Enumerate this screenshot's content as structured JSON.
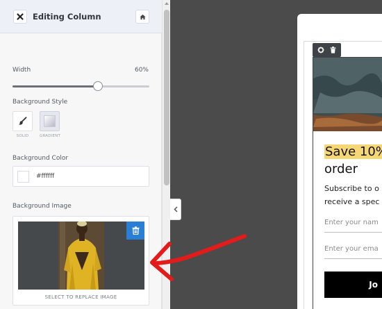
{
  "header": {
    "title": "Editing Column",
    "close_icon": "close-icon",
    "home_icon": "home-icon"
  },
  "width": {
    "label": "Width",
    "value_label": "60%",
    "value": 0.6
  },
  "background_style": {
    "label": "Background Style",
    "options": [
      {
        "caption": "SOLID",
        "icon": "brush-icon",
        "selected": false
      },
      {
        "caption": "GRADIENT",
        "icon": "gradient-icon",
        "selected": true
      }
    ]
  },
  "background_color": {
    "label": "Background Color",
    "value": "#ffffff"
  },
  "background_image": {
    "label": "Background Image",
    "replace_text": "SELECT TO REPLACE IMAGE",
    "delete_icon": "trash-icon"
  },
  "preview": {
    "headline_highlight": "Save 10%",
    "headline_rest": "order",
    "subtext_line1": "Subscribe to o",
    "subtext_line2": "receive a spec",
    "name_placeholder": "Enter your nam",
    "email_placeholder": "Enter your ema",
    "cta_label": "Jo"
  },
  "colors": {
    "accent_blue": "#2a7fd4",
    "highlight_yellow": "#f6d776",
    "annotation_red": "#e21b1b"
  }
}
